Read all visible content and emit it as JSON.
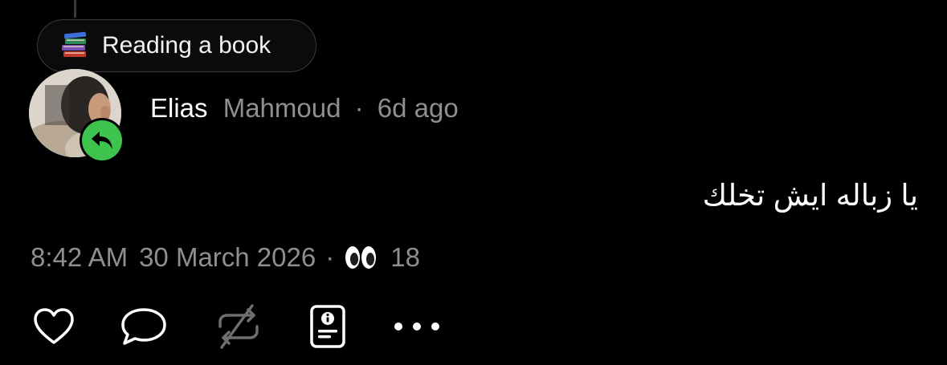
{
  "status": {
    "emoji_icon": "books-icon",
    "text": "Reading a book"
  },
  "author": {
    "display_name": "Elias",
    "username": "Mahmoud",
    "separator": "·",
    "time_ago": "6d ago",
    "badge_icon": "reply-arrow-icon",
    "badge_color": "#3ec34f"
  },
  "post": {
    "text": "يا زباله ايش تخلك"
  },
  "meta": {
    "time": "8:42 AM",
    "date": "30 March 2026",
    "separator": "·",
    "views_icon": "eyes-icon",
    "views": "18"
  },
  "actions": [
    {
      "name": "like",
      "icon": "heart-icon"
    },
    {
      "name": "reply",
      "icon": "speech-bubble-icon"
    },
    {
      "name": "repost",
      "icon": "repost-disabled-icon"
    },
    {
      "name": "info",
      "icon": "info-card-icon"
    },
    {
      "name": "more",
      "icon": "more-dots-icon"
    }
  ]
}
